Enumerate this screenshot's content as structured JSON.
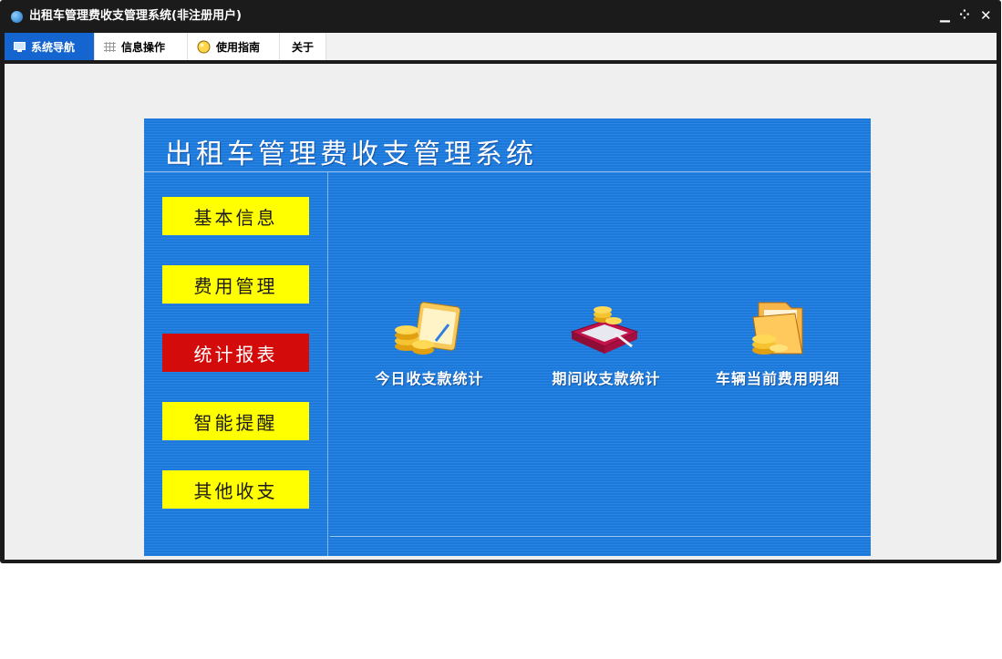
{
  "window": {
    "title": "出租车管理费收支管理系统(非注册用户)",
    "controls": {
      "minimize": "▁",
      "restore": "⁘",
      "close": "✕"
    }
  },
  "menu": {
    "tabs": [
      {
        "label": "系统导航",
        "icon": "monitor-icon",
        "active": true
      },
      {
        "label": "信息操作",
        "icon": "grid-icon",
        "active": false
      },
      {
        "label": "使用指南",
        "icon": "bulb-icon",
        "active": false
      },
      {
        "label": "关于",
        "icon": "",
        "active": false
      }
    ]
  },
  "panel": {
    "title": "出租车管理费收支管理系统",
    "nav": [
      {
        "label": "基本信息",
        "active": false
      },
      {
        "label": "费用管理",
        "active": false
      },
      {
        "label": "统计报表",
        "active": true
      },
      {
        "label": "智能提醒",
        "active": false
      },
      {
        "label": "其他收支",
        "active": false
      }
    ],
    "features": [
      {
        "label": "今日收支款统计",
        "icon": "coins-card-icon"
      },
      {
        "label": "期间收支款统计",
        "icon": "book-coins-icon"
      },
      {
        "label": "车辆当前费用明细",
        "icon": "folder-coins-icon"
      }
    ]
  },
  "colors": {
    "panel_bg": "#1e7ee2",
    "nav_button": "#ffff00",
    "nav_button_active": "#d40b0b",
    "tab_active": "#1565d0"
  }
}
